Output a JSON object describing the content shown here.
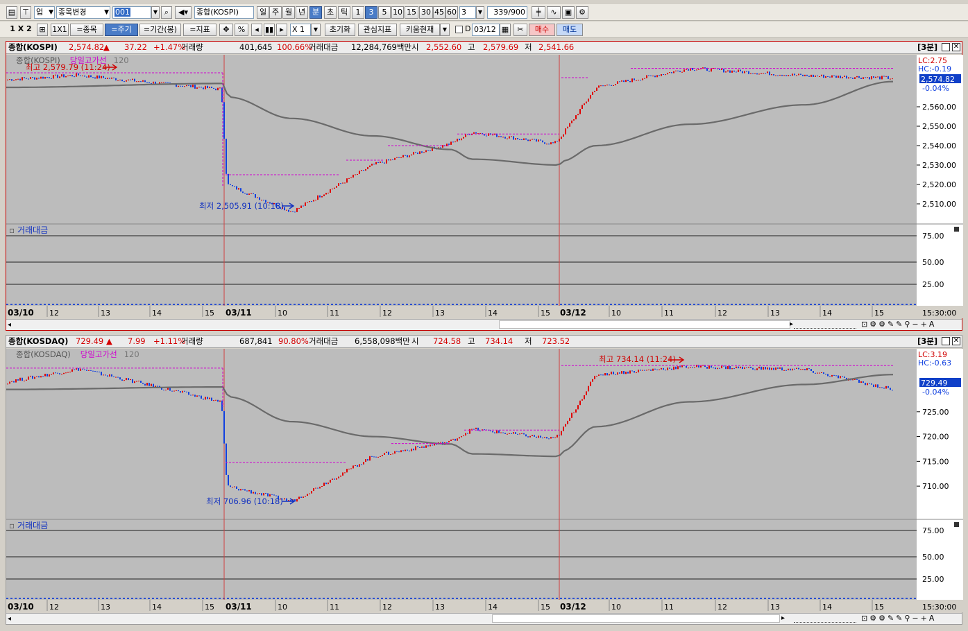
{
  "toolbar1": {
    "market_select": "업",
    "code_change": "종목변경",
    "code_input": "001",
    "index_name": "종합(KOSPI)",
    "periods": [
      "일",
      "주",
      "월",
      "년",
      "분",
      "초",
      "틱"
    ],
    "selected_period": "분",
    "intervals": [
      "1",
      "3",
      "5",
      "10",
      "15",
      "30",
      "45",
      "60"
    ],
    "selected_interval": "3",
    "interval_value": "3",
    "bar_count": "339",
    "bar_total": "/900"
  },
  "toolbar2": {
    "layout_label": "1 X 2",
    "one_by_one": "1X1",
    "eq_code": "=종목",
    "eq_period": "=주기",
    "eq_range": "=기간(봉)",
    "eq_indicator": "=지표",
    "percent": "%",
    "zoom": "X 1",
    "reset": "초기화",
    "watch": "관심지표",
    "kiwoom": "키움현재",
    "d_check": "D",
    "date": "03/12",
    "buy": "매수",
    "sell": "매도"
  },
  "panels": [
    {
      "name": "종합(KOSPI)",
      "price": "2,574.82",
      "arrow": "▲",
      "change": "37.22",
      "pct": "+1.47%",
      "vol_label": "거래량",
      "vol": "401,645",
      "vol_pct": "100.66%",
      "amt_label": "거래대금",
      "amt": "12,284,769백만",
      "open_label": "시",
      "open": "2,552.60",
      "high_label": "고",
      "high": "2,579.69",
      "low_label": "저",
      "low": "2,541.66",
      "timeframe": "[3분]",
      "legend_name": "종합(KOSPI)",
      "legend_high": "당일고가선",
      "legend_ma": "120",
      "hi_marker": "최고 2,579.79 (11:24)",
      "lo_marker": "최저 2,505.91 (10:18)",
      "lc": "LC:2.75",
      "hc": "HC:-0.19",
      "last": "2,574.82",
      "last_pct": "-0.04%",
      "yticks": [
        "2,560.00",
        "2,550.00",
        "2,540.00",
        "2,530.00",
        "2,520.00",
        "2,510.00"
      ],
      "sub_title": "거래대금",
      "sub_ticks": [
        "75.00",
        "50.00",
        "25.00"
      ],
      "dates": [
        "03/10",
        "03/11",
        "03/12"
      ],
      "hours": [
        "12",
        "13",
        "14",
        "15",
        "10",
        "11",
        "12",
        "13",
        "14",
        "15",
        "10",
        "11",
        "12",
        "13",
        "14",
        "15"
      ],
      "end_time": "15:30:00"
    },
    {
      "name": "종합(KOSDAQ)",
      "price": "729.49",
      "arrow": "▲",
      "change": "7.99",
      "pct": "+1.11%",
      "vol_label": "거래량",
      "vol": "687,841",
      "vol_pct": "90.80%",
      "amt_label": "거래대금",
      "amt": "6,558,098백만",
      "open_label": "시",
      "open": "724.58",
      "high_label": "고",
      "high": "734.14",
      "low_label": "저",
      "low": "723.52",
      "timeframe": "[3분]",
      "legend_name": "종합(KOSDAQ)",
      "legend_high": "당일고가선",
      "legend_ma": "120",
      "hi_marker": "최고 734.14 (11:24)",
      "lo_marker": "최저 706.96 (10:18)",
      "lc": "LC:3.19",
      "hc": "HC:-0.63",
      "last": "729.49",
      "last_pct": "-0.04%",
      "yticks": [
        "725.00",
        "720.00",
        "715.00",
        "710.00"
      ],
      "sub_title": "거래대금",
      "sub_ticks": [
        "75.00",
        "50.00",
        "25.00"
      ],
      "dates": [
        "03/10",
        "03/11",
        "03/12"
      ],
      "hours": [
        "12",
        "13",
        "14",
        "15",
        "10",
        "11",
        "12",
        "13",
        "14",
        "15",
        "10",
        "11",
        "12",
        "13",
        "14",
        "15"
      ],
      "end_time": "15:30:00"
    }
  ],
  "chart_data": [
    {
      "type": "candlestick",
      "title": "종합(KOSPI) 3분",
      "x": [
        "03/10 11:00",
        "03/10 15:30",
        "03/11 09:00",
        "03/11 10:18",
        "03/11 12:00",
        "03/11 13:00",
        "03/11 14:00",
        "03/11 15:30",
        "03/12 09:00",
        "03/12 10:00",
        "03/12 11:24",
        "03/12 13:00",
        "03/12 15:30"
      ],
      "series": [
        {
          "name": "종합(KOSPI)",
          "values": [
            2576.0,
            2569.0,
            2520.0,
            2505.91,
            2530.0,
            2541.0,
            2547.0,
            2541.0,
            2545.0,
            2570.0,
            2579.79,
            2576.0,
            2574.82
          ]
        },
        {
          "name": "120",
          "values": [
            2570.0,
            2572.0,
            2565.0,
            2554.0,
            2545.0,
            2538.0,
            2533.0,
            2530.0,
            2532.0,
            2540.0,
            2551.0,
            2561.0,
            2573.0
          ]
        }
      ],
      "ylim": [
        2500,
        2585
      ]
    },
    {
      "type": "candlestick",
      "title": "종합(KOSDAQ) 3분",
      "x": [
        "03/10 11:00",
        "03/10 15:30",
        "03/11 09:00",
        "03/11 10:18",
        "03/11 12:00",
        "03/11 13:00",
        "03/11 14:00",
        "03/11 15:30",
        "03/12 09:00",
        "03/12 10:00",
        "03/12 11:24",
        "03/12 13:00",
        "03/12 15:30"
      ],
      "series": [
        {
          "name": "종합(KOSDAQ)",
          "values": [
            733.5,
            727.0,
            710.0,
            706.96,
            716.0,
            719.0,
            721.5,
            719.5,
            721.0,
            732.5,
            734.14,
            733.5,
            729.49
          ]
        },
        {
          "name": "120",
          "values": [
            729.5,
            730.0,
            728.0,
            723.0,
            720.0,
            718.5,
            716.5,
            716.0,
            717.0,
            722.0,
            727.0,
            730.5,
            732.5
          ]
        }
      ],
      "ylim": [
        704,
        737
      ]
    }
  ]
}
